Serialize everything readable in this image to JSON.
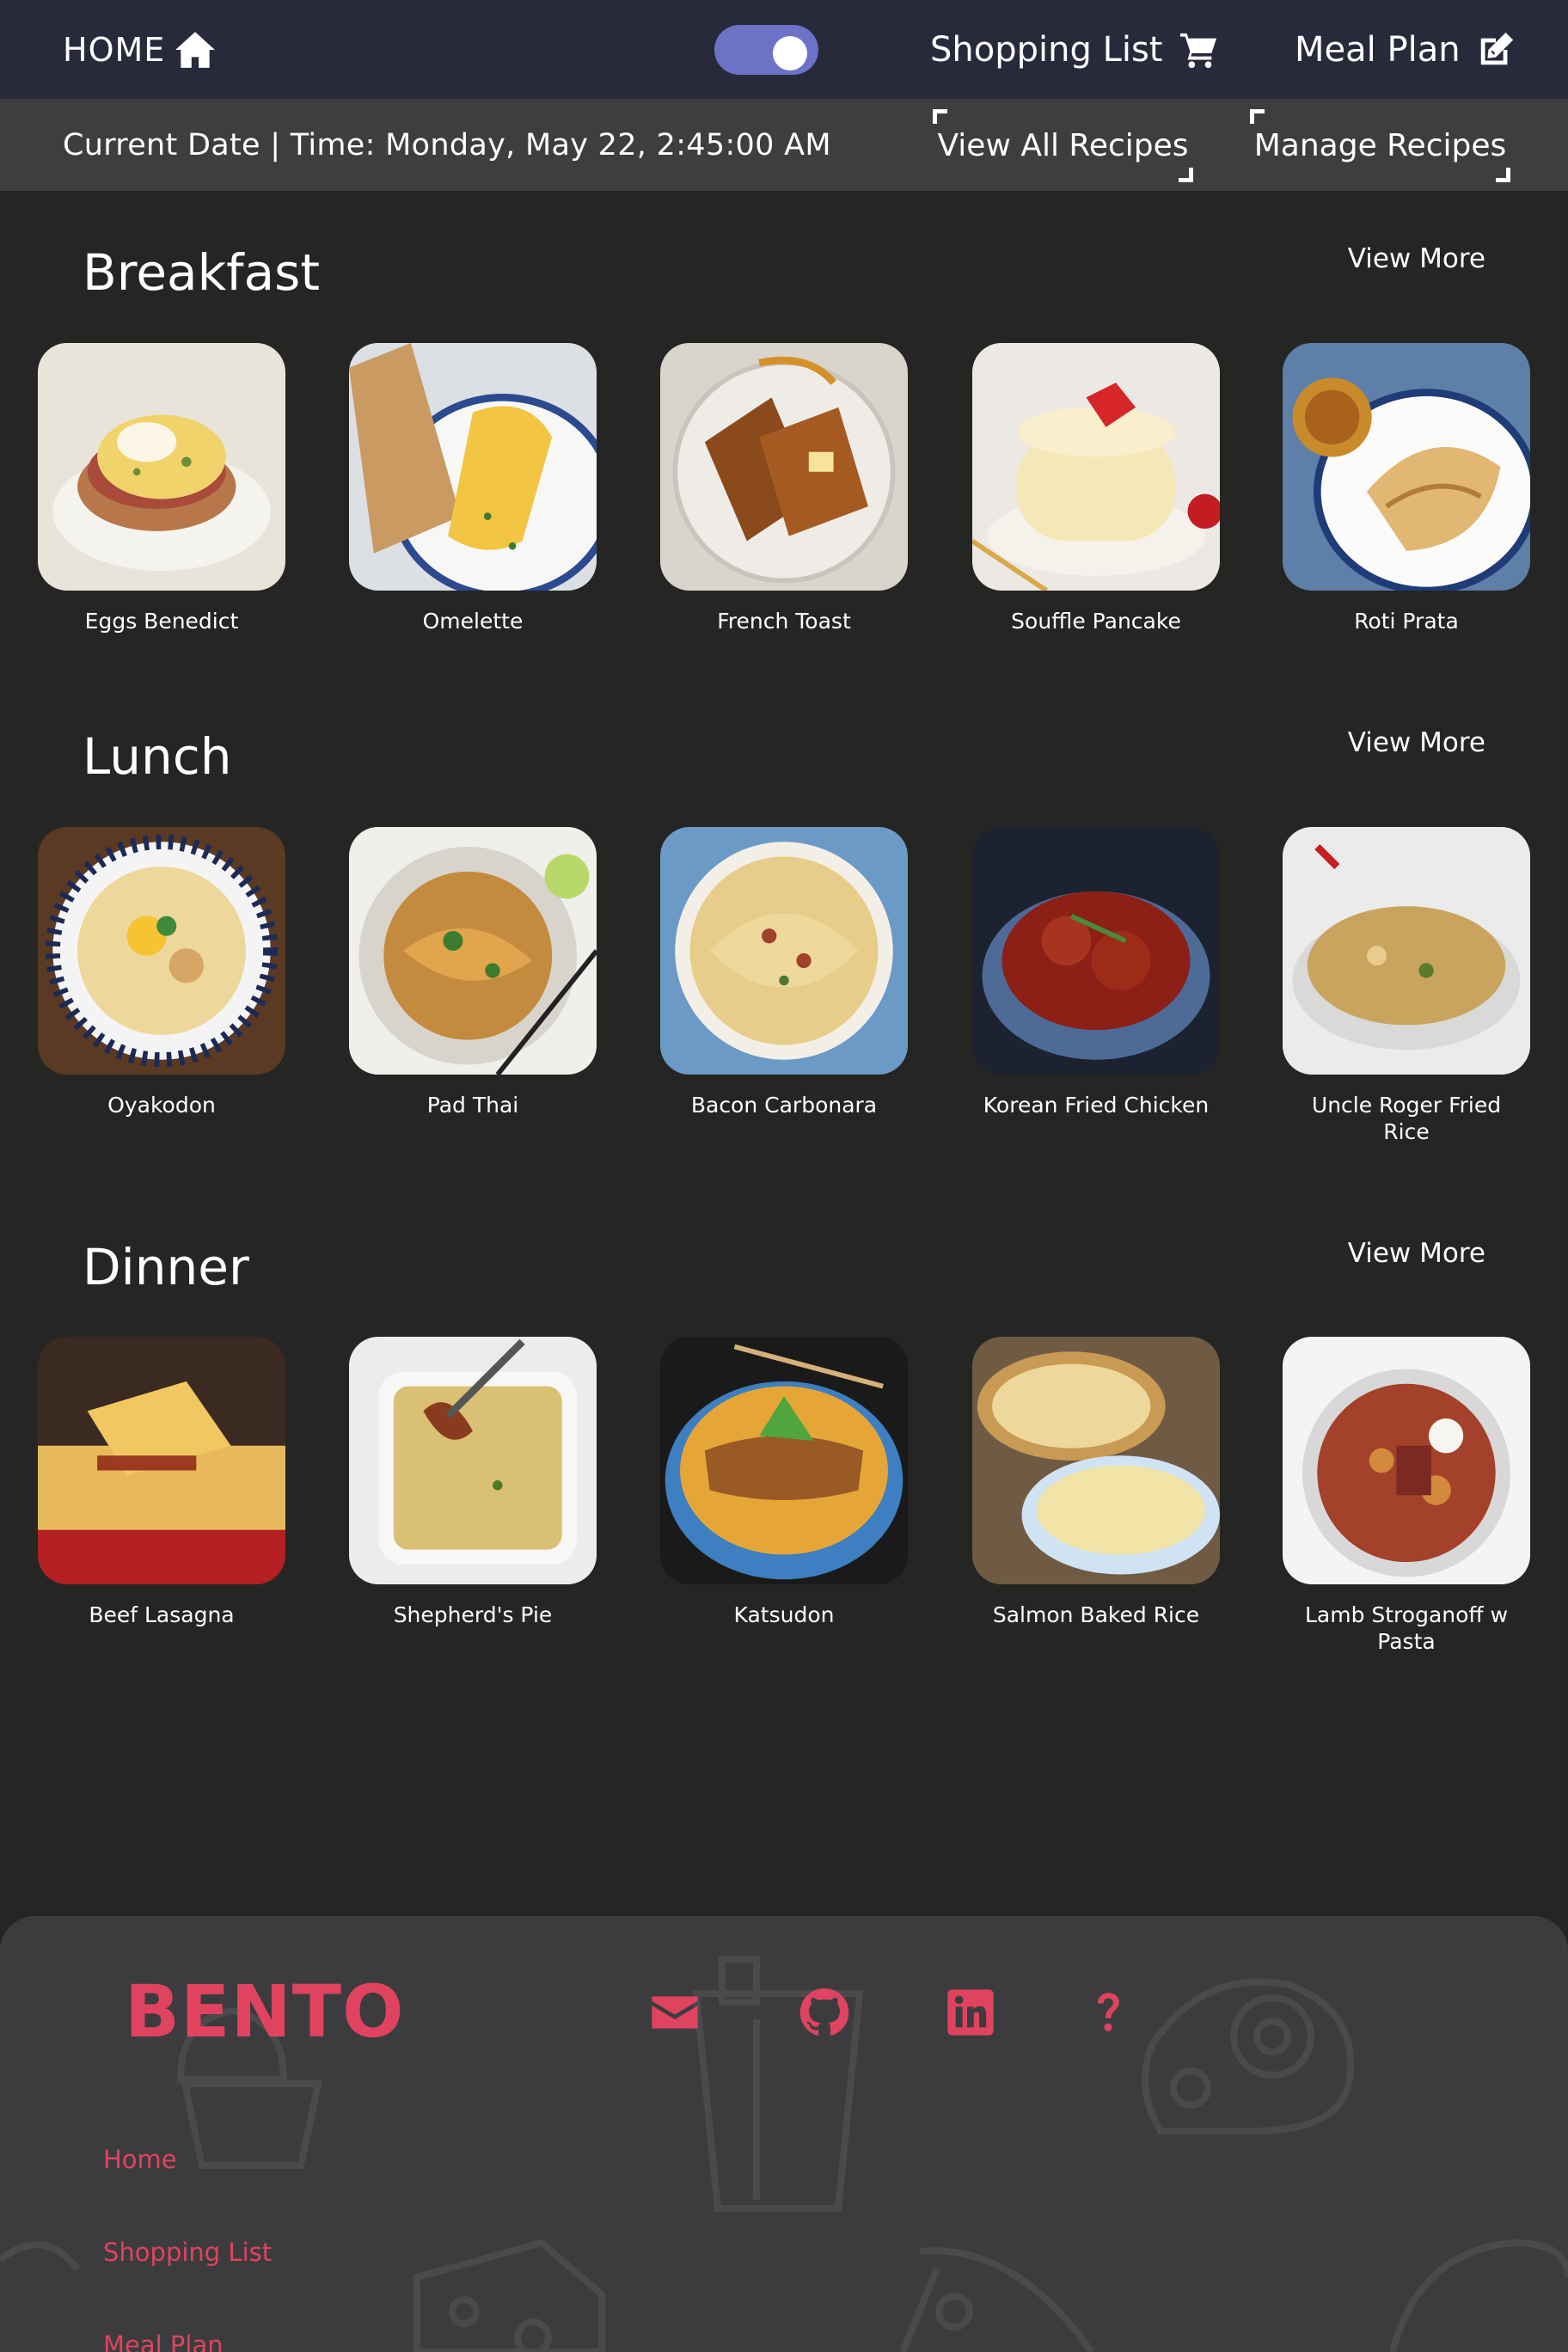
{
  "nav": {
    "home_label": "HOME",
    "home_icon": "home-icon",
    "theme_toggle": "on",
    "shopping_label": "Shopping List",
    "shopping_icon": "cart-icon",
    "meal_label": "Meal Plan",
    "meal_icon": "edit-icon"
  },
  "subbar": {
    "datetime": "Current Date | Time: Monday, May 22, 2:45:00 AM",
    "view_all": "View All Recipes",
    "manage": "Manage Recipes"
  },
  "sections": {
    "breakfast": {
      "title": "Breakfast",
      "view_more": "View More",
      "items": [
        "Eggs Benedict",
        "Omelette",
        "French Toast",
        "Souffle Pancake",
        "Roti Prata"
      ]
    },
    "lunch": {
      "title": "Lunch",
      "view_more": "View More",
      "items": [
        "Oyakodon",
        "Pad Thai",
        "Bacon Carbonara",
        "Korean Fried Chicken",
        "Uncle Roger Fried Rice"
      ]
    },
    "dinner": {
      "title": "Dinner",
      "view_more": "View More",
      "items": [
        "Beef Lasagna",
        "Shepherd's Pie",
        "Katsudon",
        "Salmon Baked Rice",
        "Lamb Stroganoff w Pasta"
      ]
    }
  },
  "footer": {
    "brand": "BENTO",
    "social_icons": [
      "mail-icon",
      "github-icon",
      "linkedin-icon",
      "help-icon"
    ],
    "links": [
      "Home",
      "Shopping List",
      "Meal Plan"
    ]
  },
  "colors": {
    "nav_bg": "#282a3c",
    "subbar_bg": "#3e3e3f",
    "page_bg": "#252623",
    "accent": "#e0435f",
    "toggle": "#6c72c6"
  }
}
